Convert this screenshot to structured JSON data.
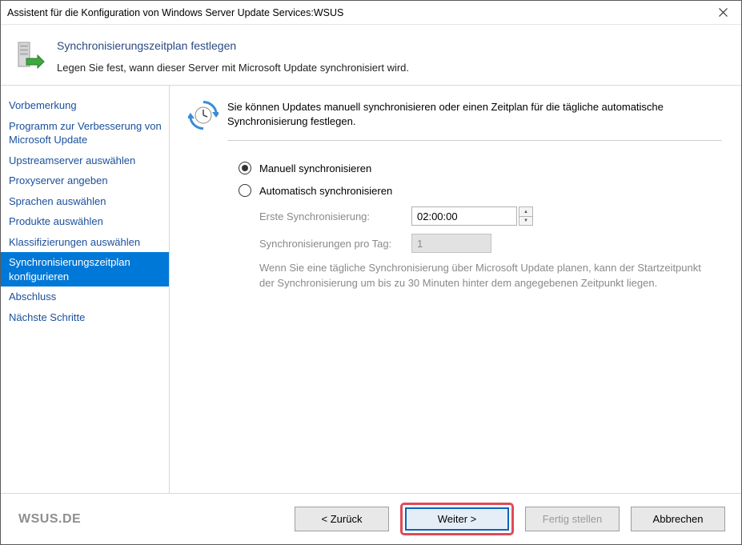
{
  "window": {
    "title": "Assistent für die Konfiguration von Windows Server Update Services:WSUS"
  },
  "header": {
    "title": "Synchronisierungszeitplan festlegen",
    "subtitle": "Legen Sie fest, wann dieser Server mit Microsoft Update synchronisiert wird."
  },
  "sidebar": {
    "items": [
      {
        "label": "Vorbemerkung"
      },
      {
        "label": "Programm zur Verbesserung von Microsoft Update"
      },
      {
        "label": "Upstreamserver auswählen"
      },
      {
        "label": "Proxyserver angeben"
      },
      {
        "label": "Sprachen auswählen"
      },
      {
        "label": "Produkte auswählen"
      },
      {
        "label": "Klassifizierungen auswählen"
      },
      {
        "label": "Synchronisierungszeitplan konfigurieren"
      },
      {
        "label": "Abschluss"
      },
      {
        "label": "Nächste Schritte"
      }
    ],
    "selected_index": 7
  },
  "content": {
    "description": "Sie können Updates manuell synchronisieren oder einen Zeitplan für die tägliche automatische Synchronisierung festlegen.",
    "radio_manual": "Manuell synchronisieren",
    "radio_auto": "Automatisch synchronisieren",
    "selected": "manual",
    "first_sync_label": "Erste Synchronisierung:",
    "first_sync_value": "02:00:00",
    "syncs_per_day_label": "Synchronisierungen pro Tag:",
    "syncs_per_day_value": "1",
    "note": "Wenn Sie eine tägliche Synchronisierung über Microsoft Update planen, kann der Startzeitpunkt der Synchronisierung um bis zu 30 Minuten hinter dem angegebenen Zeitpunkt liegen."
  },
  "footer": {
    "watermark": "WSUS.DE",
    "back": "< Zurück",
    "next": "Weiter >",
    "finish": "Fertig stellen",
    "cancel": "Abbrechen"
  }
}
